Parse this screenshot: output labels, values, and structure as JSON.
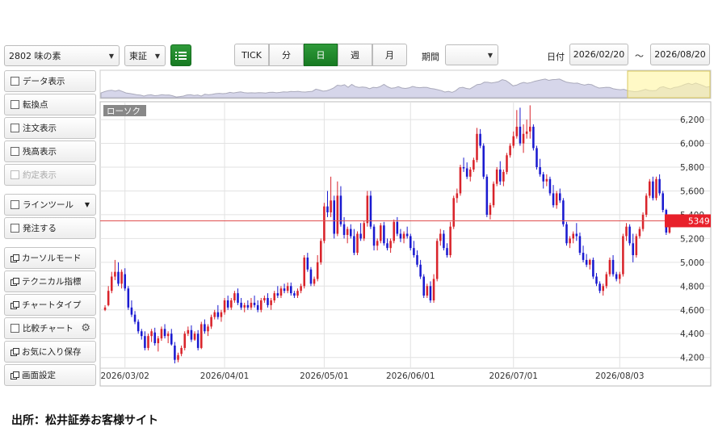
{
  "toolbar": {
    "stock_select": "2802 味の素",
    "market_select": "東証",
    "periods": [
      "TICK",
      "分",
      "日",
      "週",
      "月"
    ],
    "active_period": "日",
    "range_label": "期間",
    "range_select": "",
    "date_label": "日付",
    "date_from": "2026/02/20",
    "date_sep": "〜",
    "date_to": "2026/08/20"
  },
  "sidebar": {
    "items": [
      {
        "label": "データ表示",
        "kind": "checkbox"
      },
      {
        "label": "転換点",
        "kind": "checkbox"
      },
      {
        "label": "注文表示",
        "kind": "checkbox"
      },
      {
        "label": "残高表示",
        "kind": "checkbox"
      },
      {
        "label": "約定表示",
        "kind": "checkbox",
        "disabled": true
      },
      {
        "label": "ラインツール",
        "kind": "checkbox",
        "dropdown": true
      },
      {
        "label": "発注する",
        "kind": "checkbox"
      },
      {
        "label": "カーソルモード",
        "kind": "window"
      },
      {
        "label": "テクニカル指標",
        "kind": "window"
      },
      {
        "label": "チャートタイプ",
        "kind": "window"
      },
      {
        "label": "比較チャート",
        "kind": "checkbox",
        "gear": true
      },
      {
        "label": "お気に入り保存",
        "kind": "window"
      },
      {
        "label": "画面設定",
        "kind": "window"
      }
    ]
  },
  "chart": {
    "type_label": "ローソク",
    "last_price_label": "5349"
  },
  "footer": {
    "source": "出所：松井証券お客様サイト"
  },
  "colors": {
    "up": "#d9242b",
    "down": "#1a1ad0",
    "active": "#1e8a2a",
    "price_line": "#e05050",
    "navigator": "#d6d6ea"
  },
  "chart_data": {
    "type": "candlestick",
    "title": "ローソク",
    "y_ticks": [
      4200,
      4400,
      4600,
      4800,
      5000,
      5200,
      5400,
      5600,
      5800,
      6000,
      6200
    ],
    "ylim": [
      4130,
      6350
    ],
    "x_tick_labels": [
      "2026/03/02",
      "2026/04/01",
      "2026/05/01",
      "2026/06/01",
      "2026/07/01",
      "2026/08/03"
    ],
    "x_tick_index": [
      6,
      36,
      66,
      92,
      123,
      155
    ],
    "last_price": 5349,
    "ohlc": [
      [
        4600,
        4640,
        4590,
        4620
      ],
      [
        4640,
        4800,
        4630,
        4760
      ],
      [
        4760,
        4920,
        4740,
        4880
      ],
      [
        4880,
        5020,
        4850,
        4920
      ],
      [
        4920,
        5000,
        4800,
        4820
      ],
      [
        4820,
        4940,
        4780,
        4920
      ],
      [
        4900,
        4950,
        4760,
        4780
      ],
      [
        4780,
        4800,
        4600,
        4620
      ],
      [
        4620,
        4680,
        4540,
        4560
      ],
      [
        4560,
        4590,
        4480,
        4500
      ],
      [
        4500,
        4520,
        4400,
        4420
      ],
      [
        4420,
        4440,
        4350,
        4380
      ],
      [
        4380,
        4420,
        4260,
        4280
      ],
      [
        4280,
        4400,
        4260,
        4380
      ],
      [
        4380,
        4440,
        4330,
        4420
      ],
      [
        4410,
        4450,
        4300,
        4320
      ],
      [
        4320,
        4380,
        4250,
        4360
      ],
      [
        4360,
        4460,
        4340,
        4440
      ],
      [
        4440,
        4480,
        4360,
        4380
      ],
      [
        4380,
        4420,
        4320,
        4400
      ],
      [
        4400,
        4440,
        4300,
        4310
      ],
      [
        4300,
        4330,
        4150,
        4180
      ],
      [
        4180,
        4240,
        4160,
        4220
      ],
      [
        4230,
        4300,
        4210,
        4280
      ],
      [
        4280,
        4420,
        4260,
        4400
      ],
      [
        4400,
        4460,
        4380,
        4430
      ],
      [
        4430,
        4470,
        4330,
        4350
      ],
      [
        4350,
        4420,
        4340,
        4400
      ],
      [
        4400,
        4430,
        4260,
        4280
      ],
      [
        4280,
        4500,
        4270,
        4480
      ],
      [
        4480,
        4520,
        4400,
        4420
      ],
      [
        4420,
        4480,
        4380,
        4460
      ],
      [
        4460,
        4560,
        4440,
        4540
      ],
      [
        4540,
        4600,
        4520,
        4580
      ],
      [
        4580,
        4640,
        4520,
        4540
      ],
      [
        4540,
        4600,
        4500,
        4580
      ],
      [
        4580,
        4700,
        4560,
        4680
      ],
      [
        4680,
        4720,
        4600,
        4620
      ],
      [
        4620,
        4700,
        4600,
        4680
      ],
      [
        4680,
        4760,
        4660,
        4740
      ],
      [
        4740,
        4780,
        4640,
        4660
      ],
      [
        4660,
        4700,
        4600,
        4620
      ],
      [
        4620,
        4660,
        4580,
        4640
      ],
      [
        4640,
        4680,
        4600,
        4620
      ],
      [
        4620,
        4700,
        4600,
        4660
      ],
      [
        4660,
        4720,
        4620,
        4640
      ],
      [
        4640,
        4680,
        4580,
        4600
      ],
      [
        4600,
        4700,
        4580,
        4680
      ],
      [
        4680,
        4720,
        4660,
        4700
      ],
      [
        4700,
        4740,
        4620,
        4640
      ],
      [
        4640,
        4700,
        4600,
        4680
      ],
      [
        4680,
        4760,
        4660,
        4740
      ],
      [
        4740,
        4800,
        4700,
        4720
      ],
      [
        4720,
        4800,
        4700,
        4780
      ],
      [
        4780,
        4820,
        4740,
        4760
      ],
      [
        4760,
        4830,
        4740,
        4800
      ],
      [
        4800,
        4830,
        4720,
        4740
      ],
      [
        4740,
        4760,
        4700,
        4720
      ],
      [
        4720,
        4780,
        4700,
        4760
      ],
      [
        4760,
        4820,
        4740,
        4800
      ],
      [
        4800,
        5060,
        4780,
        5040
      ],
      [
        5040,
        5080,
        4920,
        4940
      ],
      [
        4940,
        4960,
        4800,
        4820
      ],
      [
        4820,
        4880,
        4800,
        4860
      ],
      [
        4860,
        5060,
        4840,
        5000
      ],
      [
        5000,
        5200,
        4980,
        5180
      ],
      [
        5180,
        5500,
        5160,
        5470
      ],
      [
        5470,
        5600,
        5380,
        5420
      ],
      [
        5420,
        5720,
        5380,
        5520
      ],
      [
        5520,
        5560,
        5200,
        5240
      ],
      [
        5240,
        5680,
        5220,
        5560
      ],
      [
        5560,
        5640,
        5300,
        5320
      ],
      [
        5320,
        5380,
        5200,
        5230
      ],
      [
        5230,
        5300,
        5160,
        5280
      ],
      [
        5280,
        5320,
        5200,
        5220
      ],
      [
        5220,
        5280,
        5060,
        5080
      ],
      [
        5080,
        5260,
        5060,
        5240
      ],
      [
        5240,
        5330,
        5180,
        5200
      ],
      [
        5200,
        5350,
        5180,
        5330
      ],
      [
        5330,
        5600,
        5300,
        5560
      ],
      [
        5560,
        5600,
        5280,
        5300
      ],
      [
        5300,
        5320,
        5100,
        5140
      ],
      [
        5140,
        5200,
        5100,
        5180
      ],
      [
        5180,
        5330,
        5160,
        5310
      ],
      [
        5310,
        5340,
        5140,
        5160
      ],
      [
        5160,
        5200,
        5100,
        5120
      ],
      [
        5120,
        5200,
        5080,
        5180
      ],
      [
        5180,
        5360,
        5160,
        5340
      ],
      [
        5340,
        5380,
        5220,
        5240
      ],
      [
        5240,
        5280,
        5170,
        5200
      ],
      [
        5200,
        5260,
        5160,
        5240
      ],
      [
        5240,
        5300,
        5200,
        5220
      ],
      [
        5220,
        5240,
        5100,
        5120
      ],
      [
        5120,
        5180,
        5040,
        5060
      ],
      [
        5060,
        5100,
        4960,
        4980
      ],
      [
        4980,
        5020,
        4860,
        4880
      ],
      [
        4880,
        4900,
        4700,
        4720
      ],
      [
        4720,
        4820,
        4700,
        4800
      ],
      [
        4800,
        4840,
        4660,
        4680
      ],
      [
        4680,
        4900,
        4660,
        4860
      ],
      [
        4860,
        5200,
        4840,
        5180
      ],
      [
        5180,
        5280,
        5140,
        5240
      ],
      [
        5240,
        5270,
        5100,
        5120
      ],
      [
        5120,
        5160,
        5040,
        5060
      ],
      [
        5060,
        5340,
        5040,
        5300
      ],
      [
        5300,
        5560,
        5280,
        5540
      ],
      [
        5540,
        5620,
        5500,
        5580
      ],
      [
        5580,
        5820,
        5560,
        5800
      ],
      [
        5800,
        5880,
        5760,
        5790
      ],
      [
        5790,
        5840,
        5700,
        5720
      ],
      [
        5720,
        5800,
        5680,
        5780
      ],
      [
        5780,
        5880,
        5760,
        5860
      ],
      [
        5860,
        6130,
        5840,
        6080
      ],
      [
        6080,
        6120,
        5960,
        5980
      ],
      [
        5980,
        6000,
        5700,
        5720
      ],
      [
        5720,
        5740,
        5380,
        5400
      ],
      [
        5400,
        5500,
        5360,
        5480
      ],
      [
        5480,
        5680,
        5460,
        5660
      ],
      [
        5660,
        5800,
        5640,
        5780
      ],
      [
        5780,
        5850,
        5650,
        5680
      ],
      [
        5680,
        5780,
        5640,
        5760
      ],
      [
        5760,
        5920,
        5740,
        5900
      ],
      [
        5900,
        6000,
        5880,
        5980
      ],
      [
        5980,
        6100,
        5960,
        6060
      ],
      [
        6060,
        6280,
        6040,
        6140
      ],
      [
        6140,
        6300,
        5980,
        6000
      ],
      [
        6000,
        6160,
        5920,
        6080
      ],
      [
        6080,
        6200,
        6040,
        6100
      ],
      [
        6100,
        6320,
        6040,
        6140
      ],
      [
        6140,
        6160,
        5940,
        5960
      ],
      [
        5960,
        5980,
        5780,
        5800
      ],
      [
        5800,
        5870,
        5720,
        5740
      ],
      [
        5740,
        5760,
        5620,
        5680
      ],
      [
        5680,
        5740,
        5640,
        5700
      ],
      [
        5700,
        5720,
        5560,
        5580
      ],
      [
        5580,
        5650,
        5460,
        5480
      ],
      [
        5480,
        5600,
        5450,
        5580
      ],
      [
        5580,
        5620,
        5500,
        5520
      ],
      [
        5520,
        5540,
        5300,
        5320
      ],
      [
        5320,
        5340,
        5140,
        5160
      ],
      [
        5160,
        5220,
        5120,
        5200
      ],
      [
        5200,
        5260,
        5160,
        5240
      ],
      [
        5240,
        5330,
        5180,
        5220
      ],
      [
        5220,
        5250,
        5060,
        5080
      ],
      [
        5080,
        5140,
        5000,
        5020
      ],
      [
        5020,
        5070,
        4960,
        4980
      ],
      [
        4980,
        5030,
        4940,
        5020
      ],
      [
        5020,
        5040,
        4860,
        4880
      ],
      [
        4880,
        4910,
        4800,
        4820
      ],
      [
        4820,
        4840,
        4740,
        4760
      ],
      [
        4760,
        4820,
        4720,
        4800
      ],
      [
        4800,
        4920,
        4780,
        4900
      ],
      [
        4900,
        5040,
        4880,
        5020
      ],
      [
        5020,
        5060,
        4880,
        4900
      ],
      [
        4900,
        4920,
        4840,
        4860
      ],
      [
        4860,
        4920,
        4820,
        4900
      ],
      [
        4900,
        5240,
        4880,
        5220
      ],
      [
        5220,
        5330,
        5180,
        5300
      ],
      [
        5300,
        5320,
        5140,
        5160
      ],
      [
        5160,
        5240,
        5000,
        5060
      ],
      [
        5060,
        5240,
        5040,
        5220
      ],
      [
        5220,
        5300,
        5200,
        5280
      ],
      [
        5280,
        5420,
        5260,
        5400
      ],
      [
        5400,
        5580,
        5380,
        5560
      ],
      [
        5560,
        5700,
        5540,
        5680
      ],
      [
        5680,
        5720,
        5520,
        5540
      ],
      [
        5540,
        5720,
        5520,
        5700
      ],
      [
        5700,
        5740,
        5560,
        5580
      ],
      [
        5580,
        5600,
        5420,
        5440
      ],
      [
        5440,
        5450,
        5230,
        5250
      ],
      [
        5250,
        5349,
        5240,
        5330
      ]
    ]
  }
}
